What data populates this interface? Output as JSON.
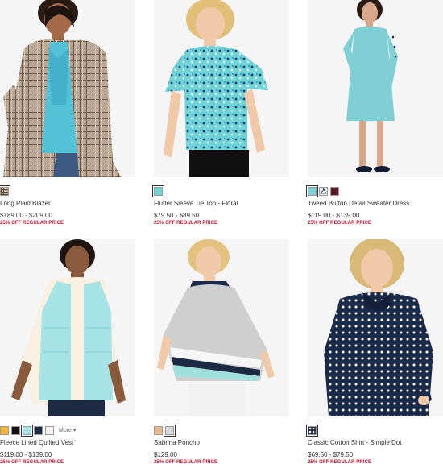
{
  "products": [
    {
      "name": "Long Plaid Blazer",
      "price": "$189.00 - $209.00",
      "promo": "25% OFF REGULAR PRICE",
      "swatches": [
        {
          "color": "#8a7a6a",
          "pattern": "plaid"
        }
      ]
    },
    {
      "name": "Flutter Sleeve Tie Top - Floral",
      "price": "$79.50 - $89.50",
      "promo": "25% OFF REGULAR PRICE",
      "swatches": [
        {
          "color": "#6fd3d8",
          "pattern": "solid"
        }
      ]
    },
    {
      "name": "Tweed Button Detail Sweater Dress",
      "price": "$119.00 - $139.00",
      "promo": "25% OFF REGULAR PRICE",
      "swatches": [
        {
          "color": "#7fcfd5",
          "pattern": "solid"
        },
        {
          "color": "#e8eef2",
          "pattern": "hanger"
        },
        {
          "color": "#5a1a24",
          "pattern": "solid"
        }
      ]
    },
    {
      "name": "Fleece Lined Quilted Vest",
      "price": "$119.00 - $139.00",
      "promo": "25% OFF REGULAR PRICE",
      "more_label": "More",
      "swatches": [
        {
          "color": "#f2b53a",
          "pattern": "solid"
        },
        {
          "color": "#111111",
          "pattern": "solid"
        },
        {
          "color": "#a6e3e6",
          "pattern": "solid"
        },
        {
          "color": "#1c2a44",
          "pattern": "solid"
        },
        {
          "color": "#fbeff0",
          "pattern": "solid"
        }
      ]
    },
    {
      "name": "Sabrina Poncho",
      "price": "$129.00",
      "promo": "25% OFF REGULAR PRICE",
      "swatches": [
        {
          "color": "#e8b88a",
          "pattern": "solid"
        },
        {
          "color": "#d8d8d8",
          "pattern": "solid"
        }
      ]
    },
    {
      "name": "Classic Cotton Shirt - Simple Dot",
      "price": "$69.50 - $79.50",
      "promo": "25% OFF REGULAR PRICE",
      "swatches": [
        {
          "color": "#1c2a4a",
          "pattern": "dot"
        }
      ]
    }
  ]
}
